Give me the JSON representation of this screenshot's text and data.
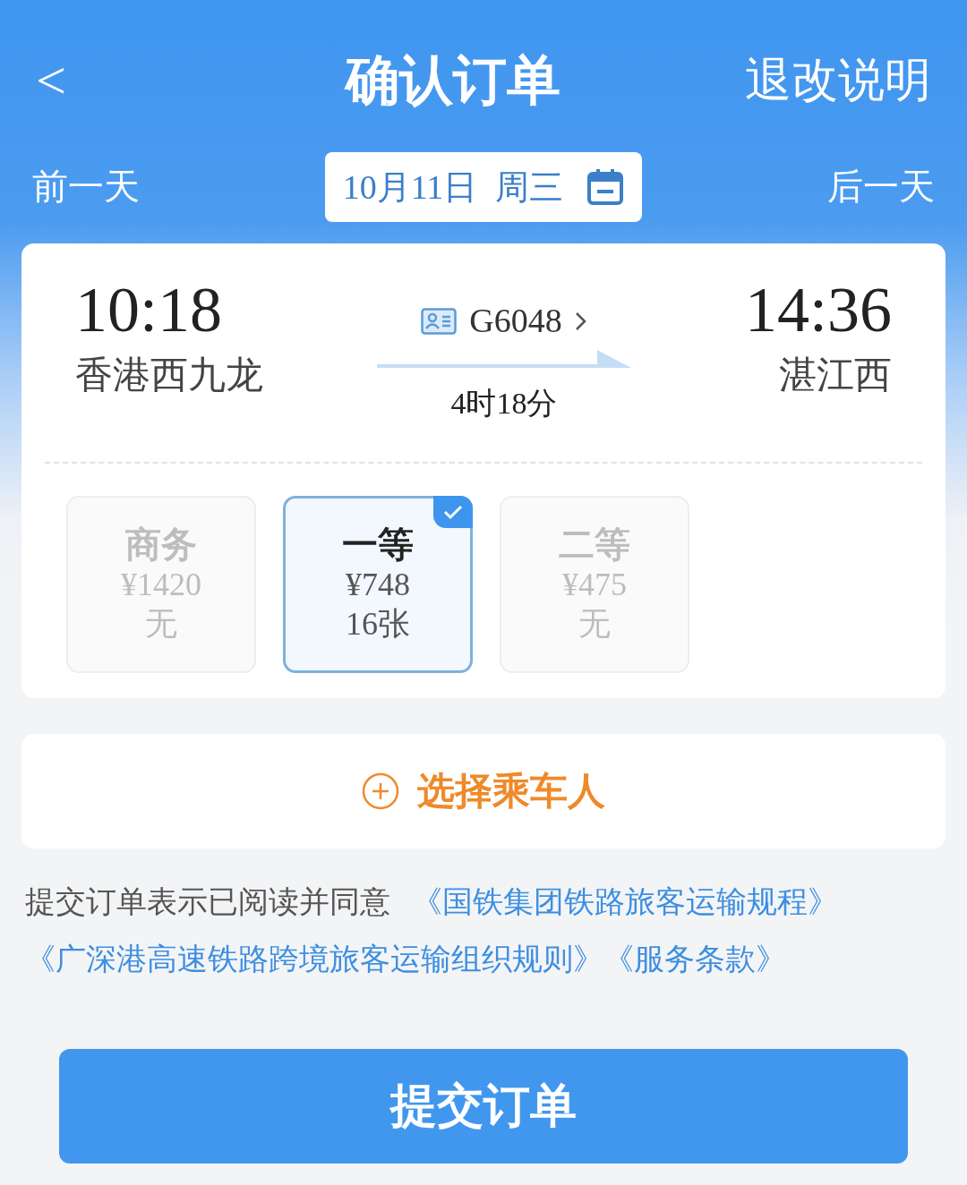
{
  "header": {
    "back": "<",
    "title": "确认订单",
    "action": "退改说明"
  },
  "date_bar": {
    "prev": "前一天",
    "date": "10月11日",
    "weekday": "周三",
    "next": "后一天"
  },
  "trip": {
    "depart_time": "10:18",
    "depart_station": "香港西九龙",
    "train": "G6048",
    "duration": "4时18分",
    "arrive_time": "14:36",
    "arrive_station": "湛江西"
  },
  "seats": [
    {
      "name": "商务",
      "price": "¥1420",
      "tickets": "无",
      "selected": false,
      "disabled": true
    },
    {
      "name": "一等",
      "price": "¥748",
      "tickets": "16张",
      "selected": true,
      "disabled": false
    },
    {
      "name": "二等",
      "price": "¥475",
      "tickets": "无",
      "selected": false,
      "disabled": true
    }
  ],
  "passenger_button": "选择乘车人",
  "agreement": {
    "text": "提交订单表示已阅读并同意",
    "links": [
      "《国铁集团铁路旅客运输规程》",
      "《广深港高速铁路跨境旅客运输组织规则》",
      "《服务条款》"
    ]
  },
  "submit": "提交订单"
}
